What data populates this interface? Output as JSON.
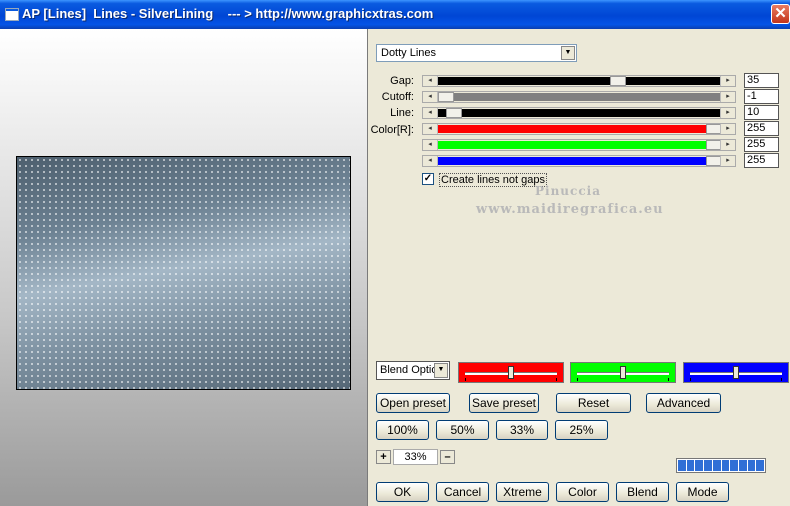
{
  "window": {
    "title": "AP [Lines]  Lines - SilverLining    --- > http://www.graphicxtras.com",
    "close_glyph": "✕"
  },
  "preset_dropdown": {
    "value": "Dotty Lines"
  },
  "params": [
    {
      "label": "Gap:",
      "value": "35",
      "track_color": "#000000",
      "level": 0.64
    },
    {
      "label": "Cutoff:",
      "value": "-1",
      "track_color": "#808080",
      "level": 0.0
    },
    {
      "label": "Line:",
      "value": "10",
      "track_color": "#000000",
      "level": 0.03
    },
    {
      "label": "Color[R]:",
      "value": "255",
      "track_color": "#ff0000",
      "level": 1.0
    },
    {
      "label": "",
      "value": "255",
      "track_color": "#00ff00",
      "level": 1.0
    },
    {
      "label": "",
      "value": "255",
      "track_color": "#0000ff",
      "level": 1.0
    }
  ],
  "checkbox": {
    "label": "Create lines not gaps",
    "checked": true
  },
  "watermark": {
    "line1": "Pinuccia",
    "line2": "www.maidiregrafica.eu"
  },
  "blend_dropdown": {
    "value": "Blend Optio"
  },
  "color_sliders": [
    {
      "color": "#ff0000",
      "level": 0.5
    },
    {
      "color": "#00ff00",
      "level": 0.5
    },
    {
      "color": "#0000ff",
      "level": 0.5
    }
  ],
  "buttons_row1": [
    "Open preset",
    "Save preset",
    "Reset",
    "Advanced"
  ],
  "zoom_buttons": [
    "100%",
    "50%",
    "33%",
    "25%"
  ],
  "zoom": {
    "plus": "+",
    "value": "33%",
    "minus": "–"
  },
  "progress": {
    "segments": 10
  },
  "bottom_buttons": [
    "OK",
    "Cancel",
    "Xtreme",
    "Color",
    "Blend",
    "Mode"
  ],
  "arrows": {
    "left": "◂",
    "right": "▸",
    "down": "▼"
  }
}
